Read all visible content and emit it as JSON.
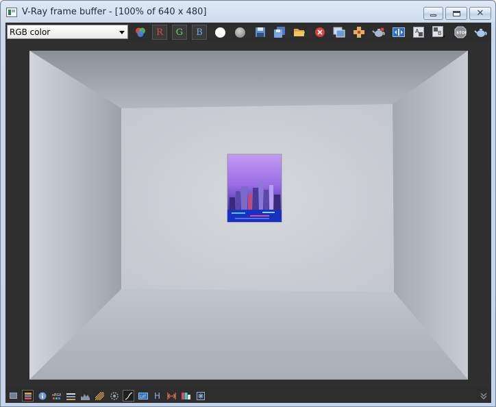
{
  "window": {
    "title": "V-Ray frame buffer - [100% of 640 x 480]"
  },
  "toolbar": {
    "channel_select": {
      "value": "RGB color"
    },
    "channels": [
      {
        "label": "R",
        "color": "#e04a4a"
      },
      {
        "label": "G",
        "color": "#6ed06e"
      },
      {
        "label": "B",
        "color": "#7aa6e6"
      }
    ],
    "icons": [
      "display-color-icon",
      "white-dot-icon",
      "gray-dot-icon",
      "save-image-icon",
      "save-all-icon",
      "open-image-icon",
      "clear-image-icon",
      "duplicate-to-frame-buffer-icon",
      "track-mouse-icon",
      "render-teapot-icon",
      "compare-ab-icon",
      "history-a-icon",
      "history-b-icon",
      "stop-render-icon",
      "last-render-teapot-icon"
    ]
  },
  "render": {
    "width": 640,
    "height": 480,
    "background_color": "#b9bec6"
  },
  "statusbar": {
    "icons": [
      "display-icon",
      "layers-icon",
      "info-icon",
      "lut-icon",
      "levels-icon",
      "histogram-icon",
      "stripes-icon",
      "lens-icon",
      "curve-icon",
      "film-icon",
      "hue-icon",
      "stereo-icon",
      "color-balance-icon",
      "sparkle-icon"
    ],
    "h_label": "H",
    "collapse_icon": "chevron-down-double-icon"
  },
  "colors": {
    "toolbar_bg": "#2d2d2d",
    "viewport_bg": "#2f2f2f",
    "accent_blue": "#8fb7e6"
  }
}
